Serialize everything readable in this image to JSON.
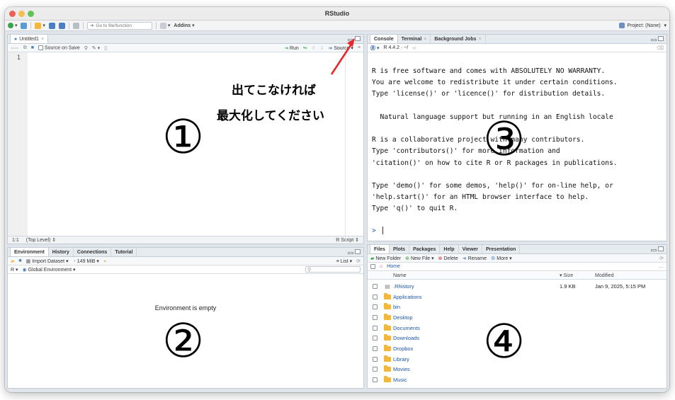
{
  "window": {
    "title": "RStudio"
  },
  "toolbar": {
    "goto_placeholder": "Go to file/function",
    "addins_label": "Addins",
    "project_label": "Project: (None)"
  },
  "source_pane": {
    "tab_label": "Untitled1",
    "source_on_save_label": "Source on Save",
    "run_label": "Run",
    "source_label": "Source",
    "line_number": "1",
    "cursor_pos": "1:1",
    "scope": "(Top Level)",
    "file_type": "R Script"
  },
  "console_pane": {
    "tabs": [
      "Console",
      "Terminal",
      "Background Jobs"
    ],
    "r_version": "R 4.4.2 · ~/",
    "output_lines": [
      "R is free software and comes with ABSOLUTELY NO WARRANTY.",
      "You are welcome to redistribute it under certain conditions.",
      "Type 'license()' or 'licence()' for distribution details.",
      "",
      "  Natural language support but running in an English locale",
      "",
      "R is a collaborative project with many contributors.",
      "Type 'contributors()' for more information and",
      "'citation()' on how to cite R or R packages in publications.",
      "",
      "Type 'demo()' for some demos, 'help()' for on-line help, or",
      "'help.start()' for an HTML browser interface to help.",
      "Type 'q()' to quit R."
    ],
    "prompt": ">"
  },
  "env_pane": {
    "tabs": [
      "Environment",
      "History",
      "Connections",
      "Tutorial"
    ],
    "import_label": "Import Dataset",
    "memory_label": "149 MiB",
    "list_label": "List",
    "lang_label": "R",
    "scope_label": "Global Environment",
    "empty_message": "Environment is empty"
  },
  "files_pane": {
    "tabs": [
      "Files",
      "Plots",
      "Packages",
      "Help",
      "Viewer",
      "Presentation"
    ],
    "new_folder_label": "New Folder",
    "new_file_label": "New File",
    "delete_label": "Delete",
    "rename_label": "Rename",
    "more_label": "More",
    "breadcrumb": "Home",
    "col_name": "Name",
    "col_size": "Size",
    "col_modified": "Modified",
    "files": [
      {
        "name": ".Rhistory",
        "size": "1.9 KB",
        "modified": "Jan 9, 2025, 5:15 PM",
        "type": "file"
      },
      {
        "name": "Applications",
        "size": "",
        "modified": "",
        "type": "folder"
      },
      {
        "name": "bin",
        "size": "",
        "modified": "",
        "type": "folder"
      },
      {
        "name": "Desktop",
        "size": "",
        "modified": "",
        "type": "folder"
      },
      {
        "name": "Documents",
        "size": "",
        "modified": "",
        "type": "folder"
      },
      {
        "name": "Downloads",
        "size": "",
        "modified": "",
        "type": "folder"
      },
      {
        "name": "Dropbox",
        "size": "",
        "modified": "",
        "type": "folder"
      },
      {
        "name": "Library",
        "size": "",
        "modified": "",
        "type": "folder"
      },
      {
        "name": "Movies",
        "size": "",
        "modified": "",
        "type": "folder"
      },
      {
        "name": "Music",
        "size": "",
        "modified": "",
        "type": "folder"
      }
    ]
  },
  "annotations": {
    "line1": "出てこなければ",
    "line2": "最大化してください",
    "circle1": "①",
    "circle2": "②",
    "circle3": "③",
    "circle4": "④"
  },
  "colors": {
    "accent_blue": "#1b57a6",
    "arrow_red": "#e8262b",
    "folder_yellow": "#f3b83b"
  }
}
